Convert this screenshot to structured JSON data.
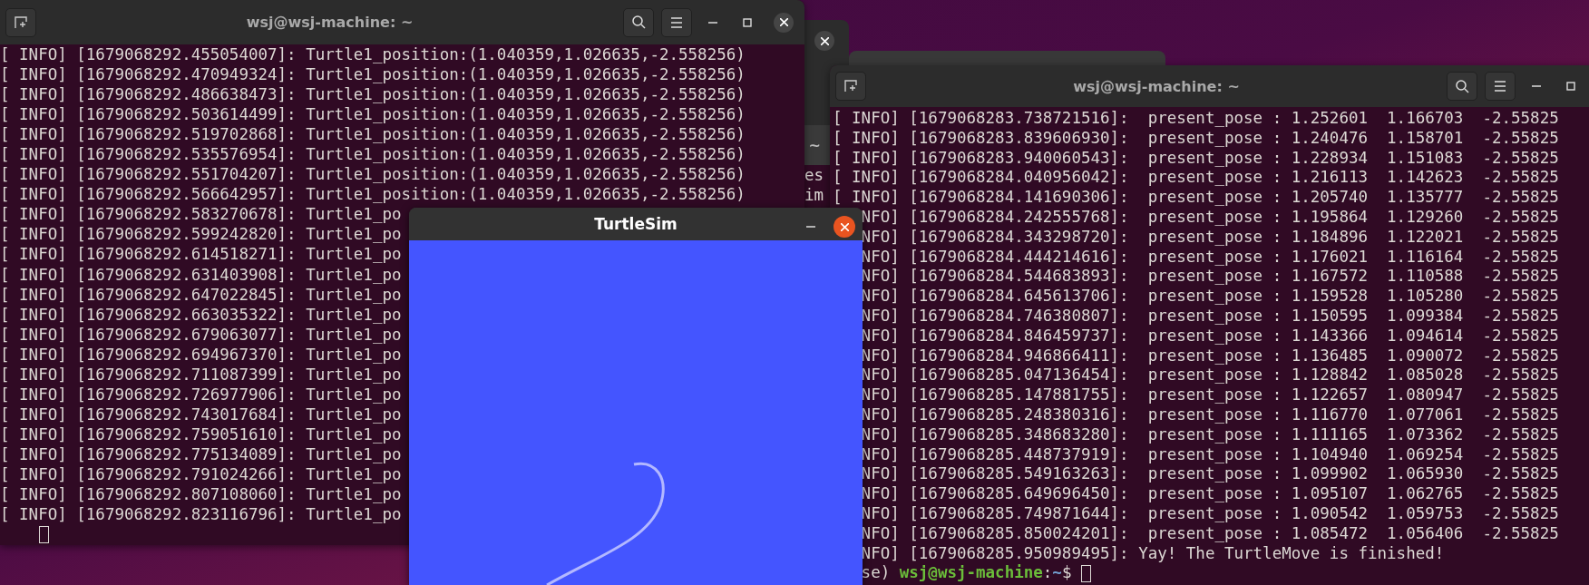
{
  "left_terminal": {
    "title": "wsj@wsj-machine: ~",
    "lines": [
      "[ INFO] [1679068292.455054007]: Turtle1_position:(1.040359,1.026635,-2.558256)",
      "[ INFO] [1679068292.470949324]: Turtle1_position:(1.040359,1.026635,-2.558256)",
      "[ INFO] [1679068292.486638473]: Turtle1_position:(1.040359,1.026635,-2.558256)",
      "[ INFO] [1679068292.503614499]: Turtle1_position:(1.040359,1.026635,-2.558256)",
      "[ INFO] [1679068292.519702868]: Turtle1_position:(1.040359,1.026635,-2.558256)",
      "[ INFO] [1679068292.535576954]: Turtle1_position:(1.040359,1.026635,-2.558256)",
      "[ INFO] [1679068292.551704207]: Turtle1_position:(1.040359,1.026635,-2.558256)",
      "[ INFO] [1679068292.566642957]: Turtle1_position:(1.040359,1.026635,-2.558256)",
      "[ INFO] [1679068292.583270678]: Turtle1_po",
      "[ INFO] [1679068292.599242820]: Turtle1_po",
      "[ INFO] [1679068292.614518271]: Turtle1_po",
      "[ INFO] [1679068292.631403908]: Turtle1_po",
      "[ INFO] [1679068292.647022845]: Turtle1_po",
      "[ INFO] [1679068292.663035322]: Turtle1_po",
      "[ INFO] [1679068292.679063077]: Turtle1_po",
      "[ INFO] [1679068292.694967370]: Turtle1_po",
      "[ INFO] [1679068292.711087399]: Turtle1_po",
      "[ INFO] [1679068292.726977906]: Turtle1_po",
      "[ INFO] [1679068292.743017684]: Turtle1_po",
      "[ INFO] [1679068292.759051610]: Turtle1_po",
      "[ INFO] [1679068292.775134089]: Turtle1_po",
      "[ INFO] [1679068292.791024266]: Turtle1_po",
      "[ INFO] [1679068292.807108060]: Turtle1_po",
      "[ INFO] [1679068292.823116796]: Turtle1_po"
    ]
  },
  "partly_hidden_terminal": {
    "title": "~",
    "lines": [
      "es",
      "im"
    ]
  },
  "right_terminal": {
    "title": "wsj@wsj-machine: ~",
    "lines": [
      "[ INFO] [1679068283.738721516]:  present_pose : 1.252601  1.166703  -2.55825",
      "[ INFO] [1679068283.839606930]:  present_pose : 1.240476  1.158701  -2.55825",
      "[ INFO] [1679068283.940060543]:  present_pose : 1.228934  1.151083  -2.55825",
      "[ INFO] [1679068284.040956042]:  present_pose : 1.216113  1.142623  -2.55825",
      "[ INFO] [1679068284.141690306]:  present_pose : 1.205740  1.135777  -2.55825"
    ],
    "lines_partly_under_turtlesim": [
      "NFO] [1679068284.242555768]:  present_pose : 1.195864  1.129260  -2.55825",
      "NFO] [1679068284.343298720]:  present_pose : 1.184896  1.122021  -2.55825",
      "NFO] [1679068284.444214616]:  present_pose : 1.176021  1.116164  -2.55825",
      "NFO] [1679068284.544683893]:  present_pose : 1.167572  1.110588  -2.55825",
      "NFO] [1679068284.645613706]:  present_pose : 1.159528  1.105280  -2.55825",
      "NFO] [1679068284.746380807]:  present_pose : 1.150595  1.099384  -2.55825",
      "NFO] [1679068284.846459737]:  present_pose : 1.143366  1.094614  -2.55825",
      "NFO] [1679068284.946866411]:  present_pose : 1.136485  1.090072  -2.55825",
      "NFO] [1679068285.047136454]:  present_pose : 1.128842  1.085028  -2.55825",
      "NFO] [1679068285.147881755]:  present_pose : 1.122657  1.080947  -2.55825",
      "NFO] [1679068285.248380316]:  present_pose : 1.116770  1.077061  -2.55825",
      "NFO] [1679068285.348683280]:  present_pose : 1.111165  1.073362  -2.55825",
      "NFO] [1679068285.448737919]:  present_pose : 1.104940  1.069254  -2.55825",
      "NFO] [1679068285.549163263]:  present_pose : 1.099902  1.065930  -2.55825",
      "NFO] [1679068285.649696450]:  present_pose : 1.095107  1.062765  -2.55825",
      "NFO] [1679068285.749871644]:  present_pose : 1.090542  1.059753  -2.55825",
      "NFO] [1679068285.850024201]:  present_pose : 1.085472  1.056406  -2.55825",
      "NFO] [1679068285.950989495]: Yay! The TurtleMove is finished!"
    ],
    "prompt": {
      "prefix": "se) ",
      "user_host": "wsj@wsj-machine",
      "separator": ":",
      "path": "~",
      "symbol": "$ "
    }
  },
  "turtlesim": {
    "title": "TurtleSim"
  }
}
